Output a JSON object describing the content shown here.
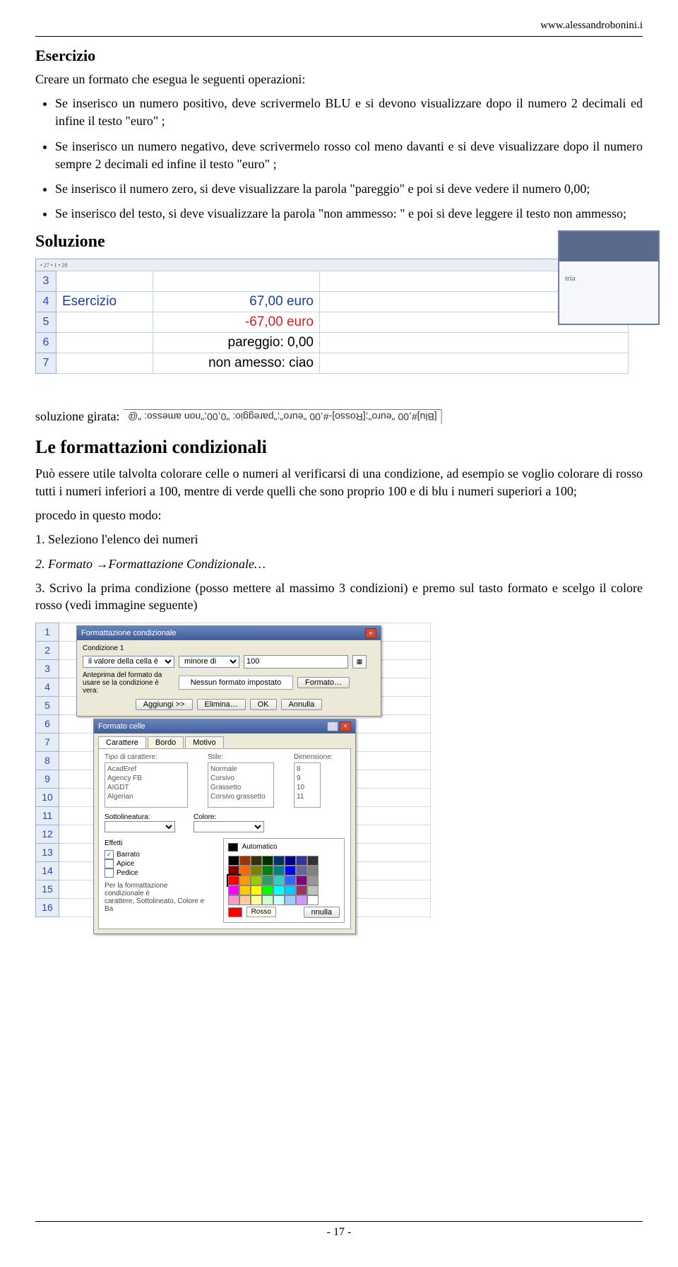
{
  "header_url": "www.alessandrobonini.i",
  "h_exercise": "Esercizio",
  "intro": "Creare un formato che esegua le seguenti operazioni:",
  "bullets": [
    "Se inserisco un numero positivo, deve scrivermelo BLU e si devono visualizzare dopo il numero 2 decimali ed infine il testo \"euro\" ;",
    "Se inserisco un numero negativo, deve scrivermelo rosso col meno davanti e si deve visualizzare dopo il numero sempre 2 decimali ed infine il testo \"euro\" ;",
    "Se inserisco il numero zero, si deve visualizzare la parola \"pareggio\" e poi si deve vedere il numero 0,00;",
    "Se inserisco del testo, si deve visualizzare la parola \"non ammesso: \" e poi si deve leggere il testo non ammesso;"
  ],
  "h_solution": "Soluzione",
  "sheet1": {
    "rowlabels": [
      "3",
      "4",
      "5",
      "6",
      "7"
    ],
    "rows": [
      {
        "label": "Esercizio",
        "value": "67,00 euro",
        "cls": "val-blue"
      },
      {
        "label": "",
        "value": "-67,00 euro",
        "cls": "val-red"
      },
      {
        "label": "",
        "value": "pareggio: 0,00",
        "cls": ""
      },
      {
        "label": "",
        "value": "non amesso: ciao",
        "cls": ""
      }
    ],
    "task_icon_text": "tria"
  },
  "girata_label": "soluzione girata:",
  "girata_formula": "[Blu]#,00 \"euro\";[Rosso]-#,00 \"euro\";\"pareggio: \"0,00;\"non amesso: \"@",
  "h_cond": "Le formattazioni condizionali",
  "cond_p1": "Può essere utile talvolta colorare celle o numeri al verificarsi di una condizione, ad esempio se voglio colorare di rosso tutti i numeri inferiori a 100, mentre di verde quelli che sono proprio 100 e di blu i numeri superiori a 100;",
  "cond_p2": "procedo in questo modo:",
  "step1": "1. Seleziono l'elenco dei numeri",
  "step2a": "2. Formato ",
  "step2b": "Formattazione Condizionale…",
  "step3": "3. Scrivo la prima condizione (posso mettere al massimo 3 condizioni) e premo sul tasto formato e scelgo il colore rosso (vedi immagine seguente)",
  "sheet2": {
    "rowcount": 16
  },
  "dlg1": {
    "title": "Formattazione condizionale",
    "cond_label": "Condizione 1",
    "sel1": "il valore della cella è",
    "sel2": "minore di",
    "val": "100",
    "preview_label": "Anteprima del formato da\nusare se la condizione è vera:",
    "preview_text": "Nessun formato impostato",
    "btn_format": "Formato…",
    "btns": [
      "Aggiungi >>",
      "Elimina…",
      "OK",
      "Annulla"
    ]
  },
  "dlg2": {
    "title": "Formato celle",
    "tabs": [
      "Carattere",
      "Bordo",
      "Motivo"
    ],
    "active_tab": 0,
    "labels": {
      "font": "Tipo di carattere:",
      "style": "Stile:",
      "size": "Dimensione:",
      "underline": "Sottolineatura:",
      "color": "Colore:"
    },
    "fonts": [
      "AcadEref",
      "Agency FB",
      "AIGDT",
      "Algerian"
    ],
    "styles": [
      "Normale",
      "Corsivo",
      "Grassetto",
      "Corsivo grassetto"
    ],
    "sizes": [
      "8",
      "9",
      "10",
      "11"
    ],
    "effects_label": "Effetti",
    "effects": [
      {
        "label": "Barrato",
        "checked": true
      },
      {
        "label": "Apice",
        "checked": false
      },
      {
        "label": "Pedice",
        "checked": false
      }
    ],
    "auto_label": "Automatico",
    "rosso_label": "Rosso",
    "note": "Per la formattazione condizionale è\ncarattere, Sottolineato, Colore e Ba",
    "annulla": "nnulla"
  },
  "swatch_colors": [
    "#000000",
    "#993300",
    "#333300",
    "#003300",
    "#003366",
    "#000080",
    "#333399",
    "#333333",
    "#800000",
    "#ff6600",
    "#808000",
    "#008000",
    "#008080",
    "#0000ff",
    "#666699",
    "#808080",
    "#ff0000",
    "#ff9900",
    "#99cc00",
    "#339966",
    "#33cccc",
    "#3366ff",
    "#800080",
    "#969696",
    "#ff00ff",
    "#ffcc00",
    "#ffff00",
    "#00ff00",
    "#00ffff",
    "#00ccff",
    "#993366",
    "#c0c0c0",
    "#ff99cc",
    "#ffcc99",
    "#ffff99",
    "#ccffcc",
    "#ccffff",
    "#99ccff",
    "#cc99ff",
    "#ffffff"
  ],
  "footer": "- 17 -"
}
